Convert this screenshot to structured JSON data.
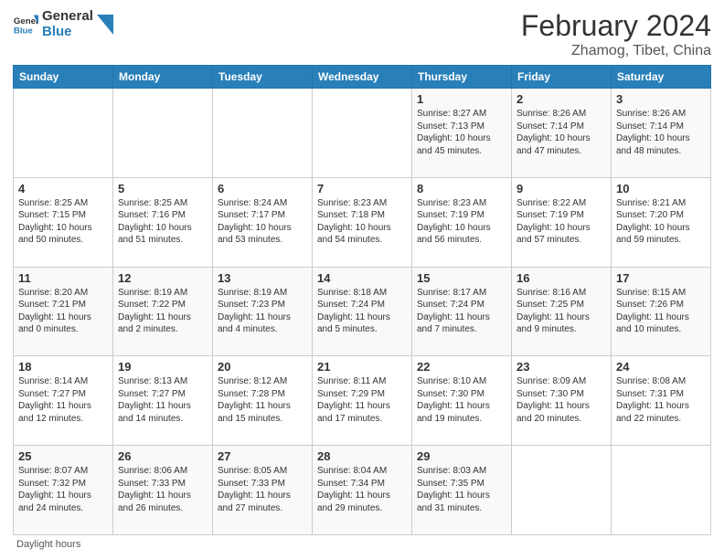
{
  "header": {
    "logo_line1": "General",
    "logo_line2": "Blue",
    "main_title": "February 2024",
    "subtitle": "Zhamog, Tibet, China"
  },
  "days_of_week": [
    "Sunday",
    "Monday",
    "Tuesday",
    "Wednesday",
    "Thursday",
    "Friday",
    "Saturday"
  ],
  "weeks": [
    [
      {
        "num": "",
        "info": ""
      },
      {
        "num": "",
        "info": ""
      },
      {
        "num": "",
        "info": ""
      },
      {
        "num": "",
        "info": ""
      },
      {
        "num": "1",
        "info": "Sunrise: 8:27 AM\nSunset: 7:13 PM\nDaylight: 10 hours\nand 45 minutes."
      },
      {
        "num": "2",
        "info": "Sunrise: 8:26 AM\nSunset: 7:14 PM\nDaylight: 10 hours\nand 47 minutes."
      },
      {
        "num": "3",
        "info": "Sunrise: 8:26 AM\nSunset: 7:14 PM\nDaylight: 10 hours\nand 48 minutes."
      }
    ],
    [
      {
        "num": "4",
        "info": "Sunrise: 8:25 AM\nSunset: 7:15 PM\nDaylight: 10 hours\nand 50 minutes."
      },
      {
        "num": "5",
        "info": "Sunrise: 8:25 AM\nSunset: 7:16 PM\nDaylight: 10 hours\nand 51 minutes."
      },
      {
        "num": "6",
        "info": "Sunrise: 8:24 AM\nSunset: 7:17 PM\nDaylight: 10 hours\nand 53 minutes."
      },
      {
        "num": "7",
        "info": "Sunrise: 8:23 AM\nSunset: 7:18 PM\nDaylight: 10 hours\nand 54 minutes."
      },
      {
        "num": "8",
        "info": "Sunrise: 8:23 AM\nSunset: 7:19 PM\nDaylight: 10 hours\nand 56 minutes."
      },
      {
        "num": "9",
        "info": "Sunrise: 8:22 AM\nSunset: 7:19 PM\nDaylight: 10 hours\nand 57 minutes."
      },
      {
        "num": "10",
        "info": "Sunrise: 8:21 AM\nSunset: 7:20 PM\nDaylight: 10 hours\nand 59 minutes."
      }
    ],
    [
      {
        "num": "11",
        "info": "Sunrise: 8:20 AM\nSunset: 7:21 PM\nDaylight: 11 hours\nand 0 minutes."
      },
      {
        "num": "12",
        "info": "Sunrise: 8:19 AM\nSunset: 7:22 PM\nDaylight: 11 hours\nand 2 minutes."
      },
      {
        "num": "13",
        "info": "Sunrise: 8:19 AM\nSunset: 7:23 PM\nDaylight: 11 hours\nand 4 minutes."
      },
      {
        "num": "14",
        "info": "Sunrise: 8:18 AM\nSunset: 7:24 PM\nDaylight: 11 hours\nand 5 minutes."
      },
      {
        "num": "15",
        "info": "Sunrise: 8:17 AM\nSunset: 7:24 PM\nDaylight: 11 hours\nand 7 minutes."
      },
      {
        "num": "16",
        "info": "Sunrise: 8:16 AM\nSunset: 7:25 PM\nDaylight: 11 hours\nand 9 minutes."
      },
      {
        "num": "17",
        "info": "Sunrise: 8:15 AM\nSunset: 7:26 PM\nDaylight: 11 hours\nand 10 minutes."
      }
    ],
    [
      {
        "num": "18",
        "info": "Sunrise: 8:14 AM\nSunset: 7:27 PM\nDaylight: 11 hours\nand 12 minutes."
      },
      {
        "num": "19",
        "info": "Sunrise: 8:13 AM\nSunset: 7:27 PM\nDaylight: 11 hours\nand 14 minutes."
      },
      {
        "num": "20",
        "info": "Sunrise: 8:12 AM\nSunset: 7:28 PM\nDaylight: 11 hours\nand 15 minutes."
      },
      {
        "num": "21",
        "info": "Sunrise: 8:11 AM\nSunset: 7:29 PM\nDaylight: 11 hours\nand 17 minutes."
      },
      {
        "num": "22",
        "info": "Sunrise: 8:10 AM\nSunset: 7:30 PM\nDaylight: 11 hours\nand 19 minutes."
      },
      {
        "num": "23",
        "info": "Sunrise: 8:09 AM\nSunset: 7:30 PM\nDaylight: 11 hours\nand 20 minutes."
      },
      {
        "num": "24",
        "info": "Sunrise: 8:08 AM\nSunset: 7:31 PM\nDaylight: 11 hours\nand 22 minutes."
      }
    ],
    [
      {
        "num": "25",
        "info": "Sunrise: 8:07 AM\nSunset: 7:32 PM\nDaylight: 11 hours\nand 24 minutes."
      },
      {
        "num": "26",
        "info": "Sunrise: 8:06 AM\nSunset: 7:33 PM\nDaylight: 11 hours\nand 26 minutes."
      },
      {
        "num": "27",
        "info": "Sunrise: 8:05 AM\nSunset: 7:33 PM\nDaylight: 11 hours\nand 27 minutes."
      },
      {
        "num": "28",
        "info": "Sunrise: 8:04 AM\nSunset: 7:34 PM\nDaylight: 11 hours\nand 29 minutes."
      },
      {
        "num": "29",
        "info": "Sunrise: 8:03 AM\nSunset: 7:35 PM\nDaylight: 11 hours\nand 31 minutes."
      },
      {
        "num": "",
        "info": ""
      },
      {
        "num": "",
        "info": ""
      }
    ]
  ],
  "footer": {
    "daylight_label": "Daylight hours"
  }
}
